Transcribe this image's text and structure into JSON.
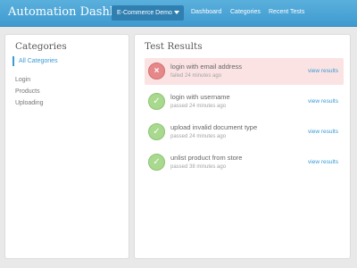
{
  "header": {
    "app_title": "Automation Dashboard",
    "project_select": "E-Commerce Demo",
    "nav": [
      "Dashboard",
      "Categories",
      "Recent Tests"
    ]
  },
  "sidebar": {
    "title": "Categories",
    "active_item": "All Categories",
    "items": [
      "Login",
      "Products",
      "Uploading"
    ]
  },
  "main": {
    "title": "Test Results",
    "results": [
      {
        "name": "login with email address",
        "status": "failed 24 minutes ago",
        "result": "failed",
        "link": "view results"
      },
      {
        "name": "login with username",
        "status": "passed 24 minutes ago",
        "result": "passed",
        "link": "view results"
      },
      {
        "name": "upload invalid document type",
        "status": "passed 24 minutes ago",
        "result": "passed",
        "link": "view results"
      },
      {
        "name": "unlist product from store",
        "status": "passed 38 minutes ago",
        "result": "passed",
        "link": "view results"
      }
    ]
  },
  "colors": {
    "accent": "#3a9bd5",
    "header_bg": "#4aa6d8",
    "fail_bg": "#fbe3e3",
    "fail_icon": "#e6888a",
    "pass_icon": "#a9d98f"
  },
  "icons": {
    "failed": "close-icon",
    "passed": "checkmark-icon"
  }
}
